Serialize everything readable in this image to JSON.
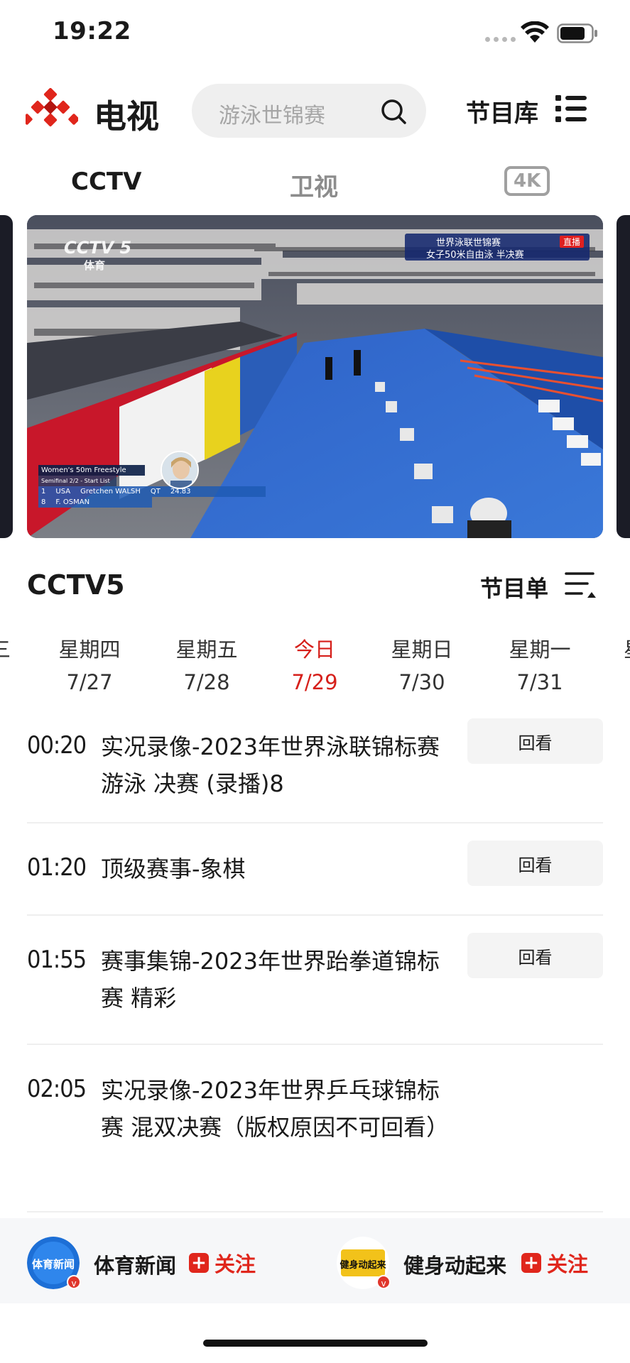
{
  "status_bar": {
    "time": "19:22"
  },
  "header": {
    "title": "电视",
    "search_placeholder": "游泳世锦赛",
    "library_label": "节目库"
  },
  "channel_tabs": [
    {
      "label": "CCTV",
      "active": true
    },
    {
      "label": "卫视",
      "active": false
    },
    {
      "label": "4K",
      "active": false
    }
  ],
  "player": {
    "watermark": "CCTV 5",
    "watermark_sub": "体育",
    "banner_title": "世界泳联世锦赛",
    "banner_sub": "女子50米自由泳 半决赛",
    "live_badge": "直播",
    "score_title": "Women's 50m Freestyle",
    "score_sub": "Semifinal 2/2 - Start List",
    "score_row1": {
      "rank": "1",
      "nation": "USA",
      "name": "Gretchen WALSH",
      "status": "QT",
      "time": "24.83"
    },
    "score_row2": {
      "rank": "8",
      "name": "F. OSMAN"
    }
  },
  "channel": {
    "name": "CCTV5",
    "schedule_label": "节目单"
  },
  "days": [
    {
      "weekday": "星期四",
      "date": "7/27",
      "active": false
    },
    {
      "weekday": "星期五",
      "date": "7/28",
      "active": false
    },
    {
      "weekday": "今日",
      "date": "7/29",
      "active": true
    },
    {
      "weekday": "星期日",
      "date": "7/30",
      "active": false
    },
    {
      "weekday": "星期一",
      "date": "7/31",
      "active": false
    }
  ],
  "programs": [
    {
      "time": "00:20",
      "title": "实况录像-2023年世界泳联锦标赛 游泳 决赛 (录播)8",
      "action": "回看"
    },
    {
      "time": "01:20",
      "title": "顶级赛事-象棋",
      "action": "回看"
    },
    {
      "time": "01:55",
      "title": "赛事集锦-2023年世界跆拳道锦标赛 精彩",
      "action": "回看"
    },
    {
      "time": "02:05",
      "title": "实况录像-2023年世界乒乓球锦标赛  混双决赛（版权原因不可回看）",
      "action": ""
    }
  ],
  "follow_bar": [
    {
      "name": "体育新闻",
      "follow_label": "关注",
      "avatar_color": "#1d6fd6",
      "avatar_text": "体育新闻"
    },
    {
      "name": "健身动起来",
      "follow_label": "关注",
      "avatar_color": "#f2c21a",
      "avatar_text": "健身动起来"
    }
  ],
  "colors": {
    "accent_red": "#d6201b",
    "logo_red": "#e0261c"
  }
}
